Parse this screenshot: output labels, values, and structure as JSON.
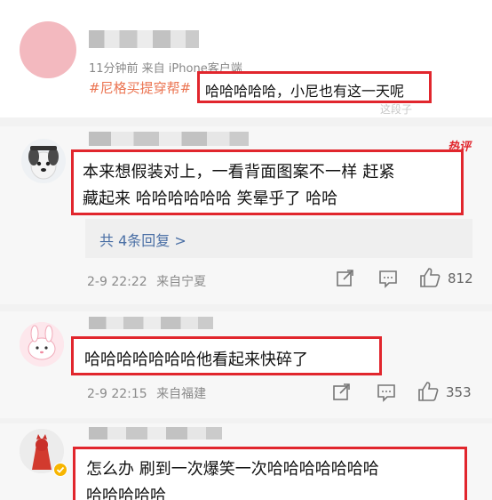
{
  "post": {
    "meta": "11分钟前  来自 iPhone客户端",
    "hashtag": "#尼格买提穿帮#",
    "text": "哈哈哈哈哈，小尼也有这一天呢",
    "faint_link": "这段子"
  },
  "comments": [
    {
      "hot_tag": "热评",
      "text_line1": "本来想假装对上，一看背面图案不一样 赶紧",
      "text_line2": "藏起来 哈哈哈哈哈哈 笑晕乎了 哈哈",
      "replies": "共 4条回复 >",
      "time": "2-9 22:22",
      "source": "来自宁夏",
      "likes": "812"
    },
    {
      "text_line1": "哈哈哈哈哈哈哈他看起来快碎了",
      "time": "2-9 22:15",
      "source": "来自福建",
      "likes": "353"
    },
    {
      "text_line1": "怎么办 刷到一次爆笑一次哈哈哈哈哈哈哈",
      "text_line2": "哈哈哈哈哈"
    }
  ],
  "icons": [
    "share-icon",
    "comment-icon",
    "like-icon",
    "verified-badge-icon"
  ],
  "colors": {
    "highlight_border": "#e1262d",
    "hashtag": "#eb7350",
    "link": "#4a6fa5"
  }
}
